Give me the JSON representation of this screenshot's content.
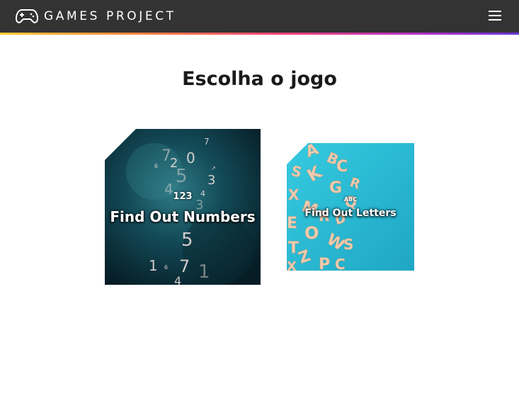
{
  "header": {
    "brand": "GAMES PROJECT",
    "brand_icon": "gamepad-icon",
    "menu_icon": "hamburger-menu-icon",
    "background_color": "#333333",
    "accent_gradient": [
      "#ffcc33",
      "#f0427a",
      "#6b34d8"
    ]
  },
  "main": {
    "title": "Escolha o jogo"
  },
  "games": [
    {
      "badge": "123",
      "label": "Find Out Numbers",
      "theme_color": "#0d3b47"
    },
    {
      "badge": "ABC",
      "label": "Find Out Letters",
      "theme_color": "#2bb8d3"
    }
  ]
}
